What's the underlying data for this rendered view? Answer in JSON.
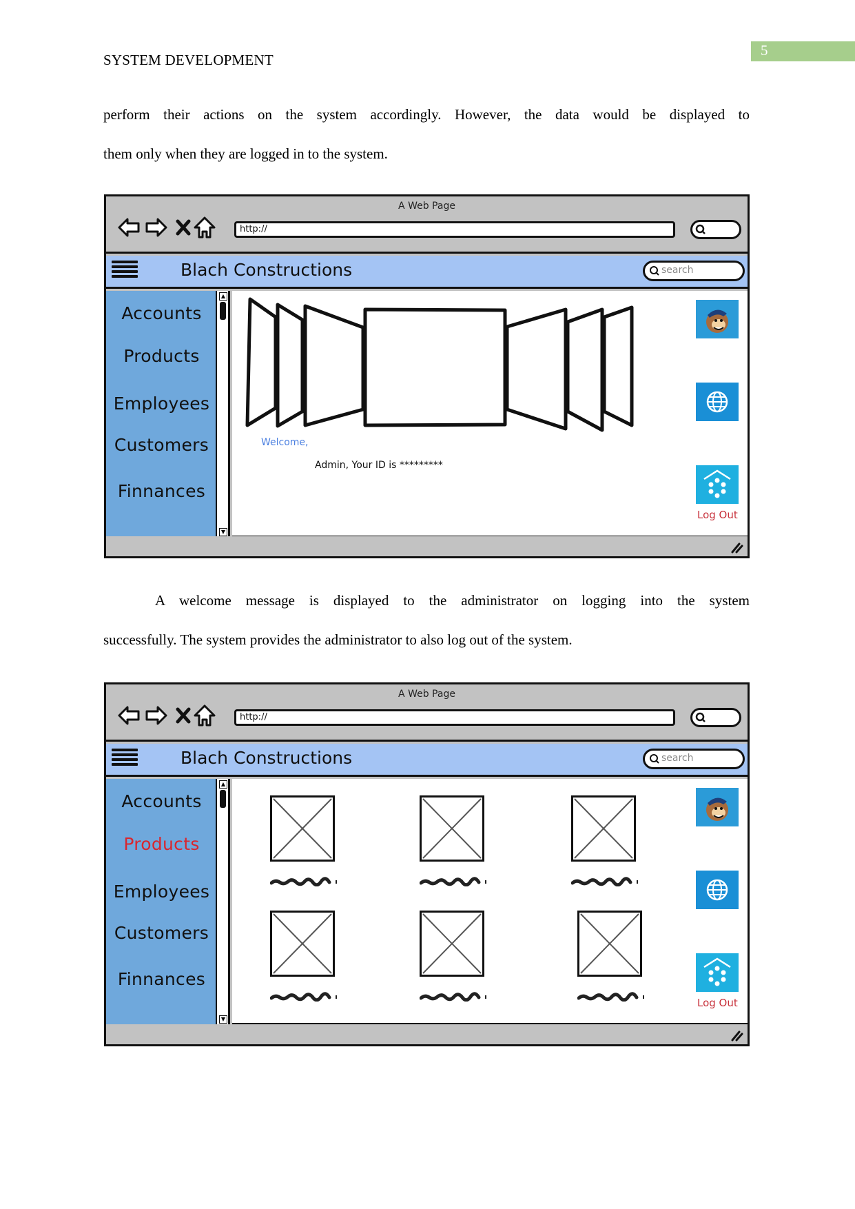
{
  "document": {
    "running_header": "SYSTEM DEVELOPMENT",
    "page_number": "5",
    "badge_color": "#a6ce8c",
    "paragraph1": {
      "line1": "perform their actions on the system accordingly. However, the data would be displayed to",
      "line2": "them only when they are logged in to the system."
    },
    "paragraph2": {
      "line1": "A welcome message is displayed to the administrator on logging into the system",
      "line2": "successfully. The system provides the administrator to also log out of the system."
    }
  },
  "mockups": [
    {
      "window_title": "A Web Page",
      "url": "http://",
      "app_title": "Blach Constructions",
      "search_placeholder": "search",
      "sidebar": [
        {
          "label": "Accounts",
          "active": false
        },
        {
          "label": "Products",
          "active": false
        },
        {
          "label": "Employees",
          "active": false
        },
        {
          "label": "Customers",
          "active": false
        },
        {
          "label": "Finnances",
          "active": false
        }
      ],
      "content": {
        "type": "cover-flow-carousel",
        "welcome": "Welcome,",
        "admin_message": "Admin, Your ID is *********"
      },
      "right_icons": [
        "mailchimp-icon",
        "globe-icon",
        "apps-icon"
      ],
      "logout_label": "Log Out"
    },
    {
      "window_title": "A Web Page",
      "url": "http://",
      "app_title": "Blach Constructions",
      "search_placeholder": "search",
      "sidebar": [
        {
          "label": "Accounts",
          "active": false
        },
        {
          "label": "Products",
          "active": true
        },
        {
          "label": "Employees",
          "active": false
        },
        {
          "label": "Customers",
          "active": false
        },
        {
          "label": "Finnances",
          "active": false
        }
      ],
      "content": {
        "type": "product-image-grid",
        "rows": 2,
        "columns": 3
      },
      "right_icons": [
        "mailchimp-icon",
        "globe-icon",
        "apps-icon"
      ],
      "logout_label": "Log Out"
    }
  ],
  "colors": {
    "chrome_gray": "#c2c2c2",
    "appbar_blue": "#a4c4f4",
    "sidebar_blue": "#6fa8dc",
    "active_nav": "#d9262e",
    "welcome_blue": "#4a7fe0",
    "logout_red": "#c8323c"
  }
}
